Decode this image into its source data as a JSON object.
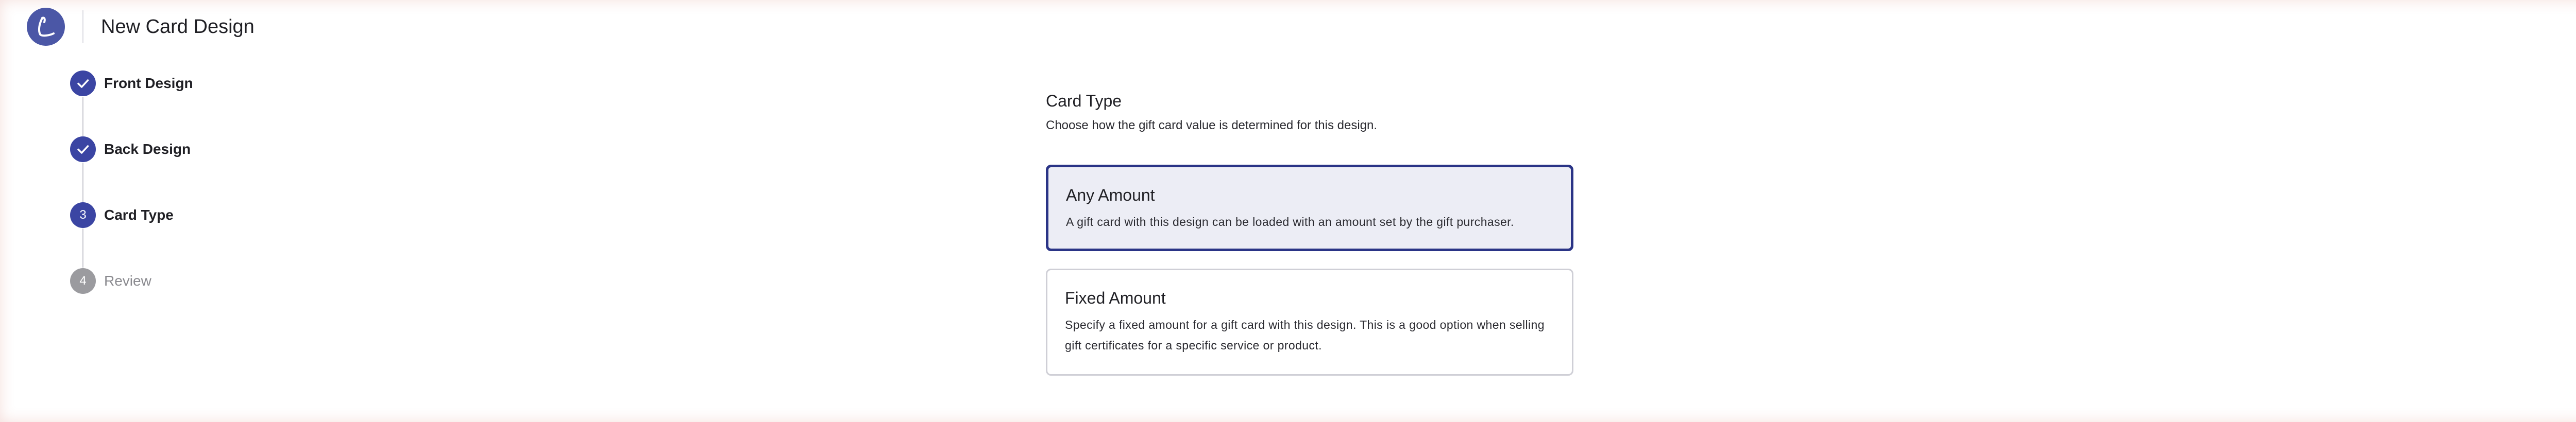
{
  "header": {
    "title": "New Card Design",
    "logo_icon": "brand-logo-icon",
    "close_icon": "close-icon"
  },
  "stepper": {
    "steps": [
      {
        "label": "Front Design",
        "status": "done",
        "number": "1"
      },
      {
        "label": "Back Design",
        "status": "done",
        "number": "2"
      },
      {
        "label": "Card Type",
        "status": "active",
        "number": "3"
      },
      {
        "label": "Review",
        "status": "pending",
        "number": "4"
      }
    ]
  },
  "card_type": {
    "title": "Card Type",
    "description": "Choose how the gift card value is determined for this design.",
    "options": [
      {
        "title": "Any Amount",
        "description": "A gift card with this design can be loaded with an amount set by the gift purchaser.",
        "selected": true
      },
      {
        "title": "Fixed Amount",
        "description": "Specify a fixed amount for a gift card with this design. This is a good option when selling gift certificates for a specific service or product.",
        "selected": false
      }
    ]
  },
  "colors": {
    "accent": "#3b45a3",
    "selected_border": "#2a3486",
    "selected_bg": "#ecedf5",
    "pending": "#9b9b9f"
  }
}
